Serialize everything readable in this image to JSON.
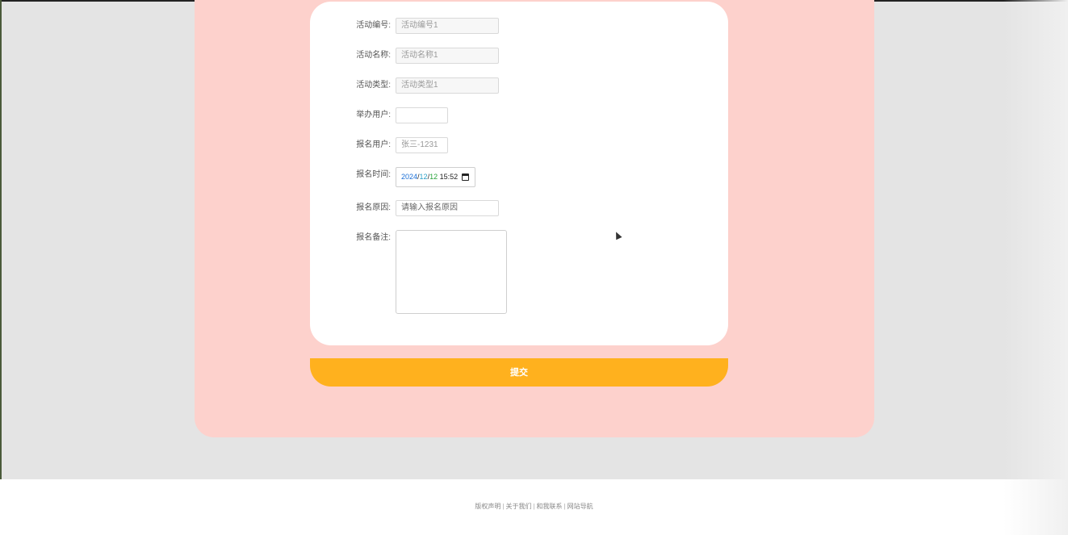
{
  "form": {
    "fields": [
      {
        "label": "活动编号:",
        "value": "活动编号1"
      },
      {
        "label": "活动名称:",
        "value": "活动名称1"
      },
      {
        "label": "活动类型:",
        "value": "活动类型1"
      },
      {
        "label": "举办用户:",
        "value": ""
      },
      {
        "label": "报名用户:",
        "value": "张三-1231"
      }
    ],
    "date": {
      "label": "报名时间:",
      "year": "2024",
      "month": "12",
      "day": "12",
      "time": "15:52"
    },
    "reason": {
      "label": "报名原因:",
      "placeholder": "请输入报名原因"
    },
    "remark": {
      "label": "报名备注:",
      "value": ""
    },
    "submit_label": "提交"
  },
  "footer": {
    "links": [
      "版权声明",
      "关于我们",
      "和我联系",
      "网站导航"
    ]
  },
  "colors": {
    "panel": "#fdd1cc",
    "submit": "#ffb11e",
    "card": "#ffffff",
    "background": "#e4e4e4"
  }
}
